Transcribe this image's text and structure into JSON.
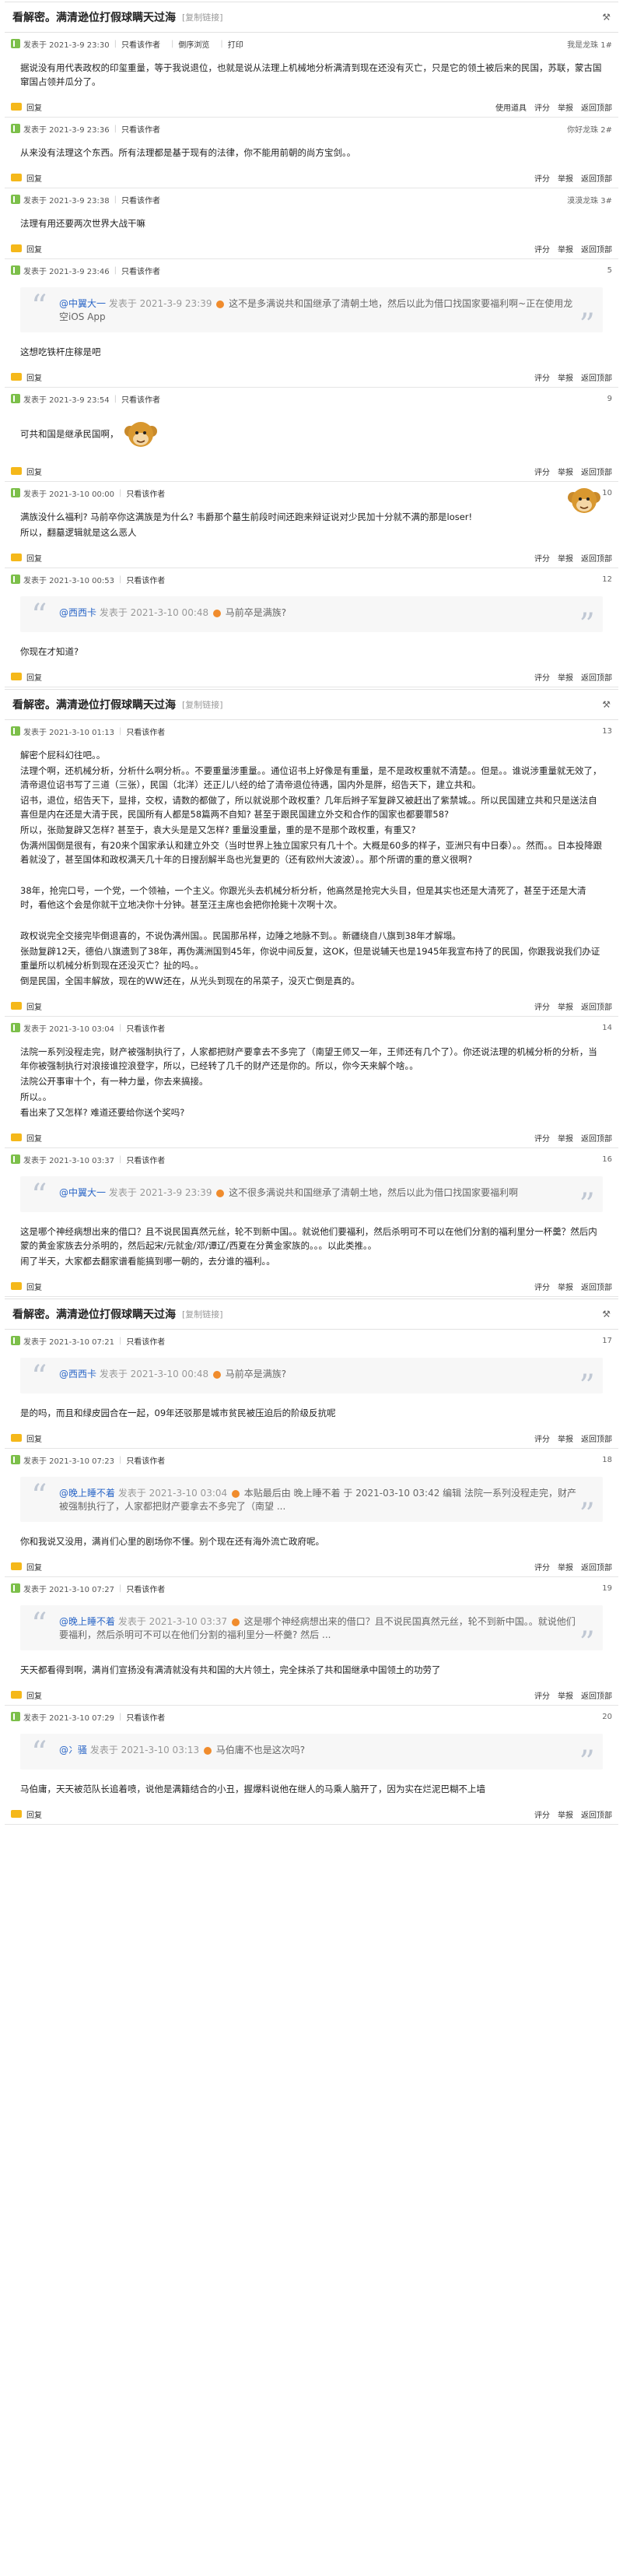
{
  "thread": {
    "title": "看解密。满清逊位打假球瞒天过海",
    "copy_link": "[复制链接]"
  },
  "labels": {
    "author": "发表于",
    "only_author": "只看该作者",
    "reverse": "倒序浏览",
    "print": "打印",
    "reply": "回复",
    "use_props": "使用道具",
    "rate": "评分",
    "report": "举报",
    "back_to_top": "返回顶部"
  },
  "posts": [
    {
      "time": "2021-3-9 23:30",
      "floor_text": "我是龙珠",
      "floor_no": "1#",
      "first": true,
      "body": [
        "据说没有用代表政权的印玺重量，等于我说退位，也就是说从法理上机械地分析满清到现在还没有灭亡，只是它的领土被后来的民国，苏联，蒙古国窜国占领并瓜分了。"
      ]
    },
    {
      "time": "2021-3-9 23:36",
      "floor_text": "你好龙珠",
      "floor_no": "2#",
      "body": [
        "从来没有法理这个东西。所有法理都是基于现有的法律，你不能用前朝的尚方宝剑。。"
      ]
    },
    {
      "time": "2021-3-9 23:38",
      "floor_text": "漠漠龙珠",
      "floor_no": "3#",
      "body": [
        "法理有用还要两次世界大战干嘛"
      ]
    },
    {
      "time": "2021-3-9 23:46",
      "floor_no": "5",
      "quote": {
        "author": "@中翼大一",
        "time": "发表于 2021-3-9 23:39",
        "text": "这不是多满说共和国继承了清朝土地，然后以此为借口找国家要福利啊~正在使用龙空iOS App"
      },
      "body": [
        "这想吃铁杆庄稼是吧"
      ]
    },
    {
      "time": "2021-3-9 23:54",
      "floor_no": "9",
      "body": [
        "可共和国是继承民国啊，"
      ],
      "monkey": true
    },
    {
      "time": "2021-3-10 00:00",
      "floor_no": "10",
      "body": [
        "满族没什么福利? 马前卒你这满族是为什么? 韦爵那个墓生前段时间还跑来辩证说对少民加十分就不满的那是loser!",
        "所以，翻墓逻辑就是这么恶人"
      ],
      "monkey_right": true
    },
    {
      "time": "2021-3-10 00:53",
      "floor_no": "12",
      "quote": {
        "author": "@西西卡",
        "time": "发表于 2021-3-10 00:48",
        "text": "马前卒是满族?"
      },
      "body": [
        "你现在才知道?"
      ]
    },
    {
      "time": "2021-3-10 01:13",
      "floor_no": "13",
      "header": true,
      "body": [
        "解密个屁科幻往吧。。",
        "法理个啊，还机械分析，分析什么啊分析。。不要重量涉重量。。通位诏书上好像是有重量，是不是政权重就不清楚。。但是。。谁说涉重量就无效了，清帝退位诏书写了三道（三张），民国（北洋）还正儿八经的给了清帝退位待遇，国内外是胖，绍告天下，建立共和。",
        "诏书，退位，绍告天下，显排，交权，请数的都做了，所以就说那个政权重？几年后辫子军复辟又被赶出了紫禁城。。所以民国建立共和只是送法自喜但是内在还是大清于民，民国所有人都是58篇两不自知? 甚至于跟民国建立外交和合作的国家也都要罪58?",
        "所以，张勋复辟又怎样? 甚至于，袁大头是是又怎样? 重量没重量，重的是不是那个政权重，有重又?",
        "伪满州国倒是很有，有20来个国家承认和建立外交（当时世界上独立国家只有几十个。大概是60多的样子，亚洲只有中日泰）。。然而。。日本投降跟着就没了，甚至国体和政权满天几十年的日搜刮解半岛也光复更的（还有欧州大波波）。。那个所谓的重的意义很啊?",
        "",
        "38年，抢完口号，一个党，一个领袖，一个主义。你跟光头去机械分析分析，他高然是抢完大头目，但是其实也还是大清死了，甚至于还是大清时，看他这个会是你就干立地决你十分钟。甚至汪主席也会把你抢毙十次啊十次。",
        "",
        "政权说完全交接完毕倒退喜的，不说伪满州国。。民国那吊样，边陲之地脉不到。。新疆绕自八旗到38年才解塌。",
        "张勋复辟12天，德伯八旗遗到了38年，再伪满洲国到45年，你说中间反复，这OK，但是说辅天也是1945年我宣布持了的民国，你跟我说我们办证重量所以机械分析到现在还没灭亡？扯的吗。。",
        "倒是民国，全国丰解放，现在的WW还在，从光头到现在的吊菜子，没灭亡倒是真的。"
      ]
    },
    {
      "time": "2021-3-10 03:04",
      "floor_no": "14",
      "body": [
        "法院一系列没程走完，财产被强制执行了，人家都把财产要拿去不多完了（南望王师又一年，王师还有几个了）。你还说法理的机械分析的分析，当年你被强制执行对浪接谁控浪登字，所以，已经转了几千的财产还是你的。所以，你今天来解个啥。。",
        "法院公开事审十个，有一种力量，你去来搞接。",
        "所以。。",
        "看出来了又怎样? 难道还要给你送个奖吗?"
      ]
    },
    {
      "time": "2021-3-10 03:37",
      "floor_no": "16",
      "quote": {
        "author": "@中翼大一",
        "time": "发表于 2021-3-9 23:39",
        "text": "这不很多满说共和国继承了清朝土地，然后以此为借口找国家要福利啊"
      },
      "body": [
        "这是哪个神经病想出来的借口？且不说民国真然元丝，轮不到新中国。。就说他们要福利，然后杀明可不可以在他们分割的福利里分一杯羹？然后内蒙的黄金家族去分杀明的，然后起宋/元就金/邓/谭辽/西夏在分黄金家族的。。。以此类推。。",
        "闹了半天，大家都去翻家谱看能搞到哪一朝的，去分谁的福利。。"
      ]
    },
    {
      "time": "2021-3-10 07:21",
      "floor_no": "17",
      "header": true,
      "quote": {
        "author": "@西西卡",
        "time": "发表于 2021-3-10 00:48",
        "text": "马前卒是满族?"
      },
      "body": [
        "是的吗，而且和绿皮园合在一起，09年还驳那是城市贫民被压迫后的阶级反抗呢"
      ]
    },
    {
      "time": "2021-3-10 07:23",
      "floor_no": "18",
      "quote": {
        "author": "@晚上睡不着",
        "time": "发表于 2021-3-10 03:04",
        "text": "本贴最后由 晚上睡不着 于 2021-03-10 03:42 编辑 法院一系列没程走完，财产被强制执行了，人家都把财产要拿去不多完了（南望 ..."
      },
      "body": [
        "你和我说又没用，满肖们心里的剧场你不懂。别个现在还有海外流亡政府呢。"
      ]
    },
    {
      "time": "2021-3-10 07:27",
      "floor_no": "19",
      "quote": {
        "author": "@晚上睡不着",
        "time": "发表于 2021-3-10 03:37",
        "text": "这是哪个神经病想出来的借口？且不说民国真然元丝，轮不到新中国。。就说他们要福利，然后杀明可不可以在他们分割的福利里分一杯羹? 然后 ..."
      },
      "body": [
        "天天都看得到啊，满肖们宣扬没有满清就没有共和国的大片领土，完全抹杀了共和国继承中国领土的功劳了"
      ]
    },
    {
      "time": "2021-3-10 07:29",
      "floor_no": "20",
      "quote": {
        "author": "@冫骚",
        "time": "发表于 2021-3-10 03:13",
        "text": "马伯庸不也是这次吗?"
      },
      "body": [
        "马伯庸，天天被范队长追着喷，说他是满籍结合的小丑，握爆料说他在继人的马乘人脑开了，因为实在烂泥巴糊不上墙"
      ]
    }
  ]
}
